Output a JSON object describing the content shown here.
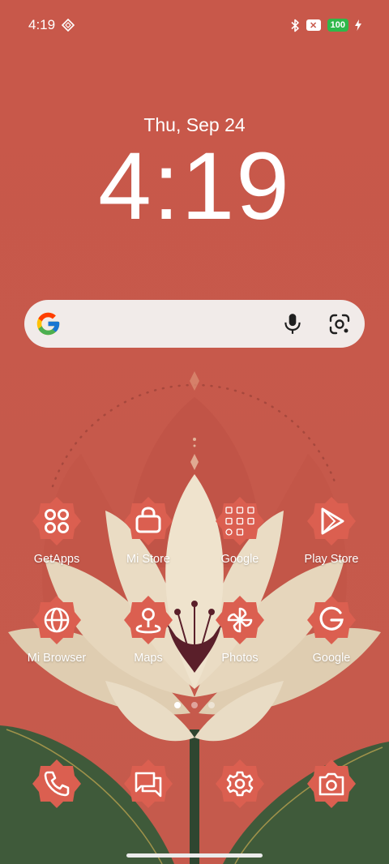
{
  "status_bar": {
    "time": "4:19",
    "icons": [
      "cast-icon",
      "bluetooth-icon",
      "x-box-icon",
      "battery-icon",
      "charging-icon"
    ],
    "battery_level": "100",
    "x_badge": "✕"
  },
  "lock": {
    "date": "Thu, Sep 24",
    "time": "4:19"
  },
  "search_bar": {
    "icons": [
      "google-g-icon",
      "microphone-icon",
      "google-lens-icon"
    ]
  },
  "apps": [
    {
      "label": "GetApps",
      "icon": "four-circles-icon"
    },
    {
      "label": "Mi Store",
      "icon": "shopping-bag-icon"
    },
    {
      "label": "Google",
      "icon": "app-folder-icon"
    },
    {
      "label": "Play Store",
      "icon": "play-triangle-icon"
    },
    {
      "label": "Mi Browser",
      "icon": "globe-icon"
    },
    {
      "label": "Maps",
      "icon": "map-pin-icon"
    },
    {
      "label": "Photos",
      "icon": "pinwheel-icon"
    },
    {
      "label": "Google",
      "icon": "google-g-icon"
    }
  ],
  "dock": [
    {
      "icon": "phone-icon"
    },
    {
      "icon": "messages-icon"
    },
    {
      "icon": "settings-gear-icon"
    },
    {
      "icon": "camera-icon"
    }
  ],
  "pager": {
    "pages": 3,
    "current": 1
  },
  "colors": {
    "background": "#c85a4c",
    "badge": "#db5f50",
    "petal": "#e8d8bf",
    "leaf": "#3f5a3a",
    "stamen": "#5a1f2a",
    "battery": "#2fb84a"
  }
}
